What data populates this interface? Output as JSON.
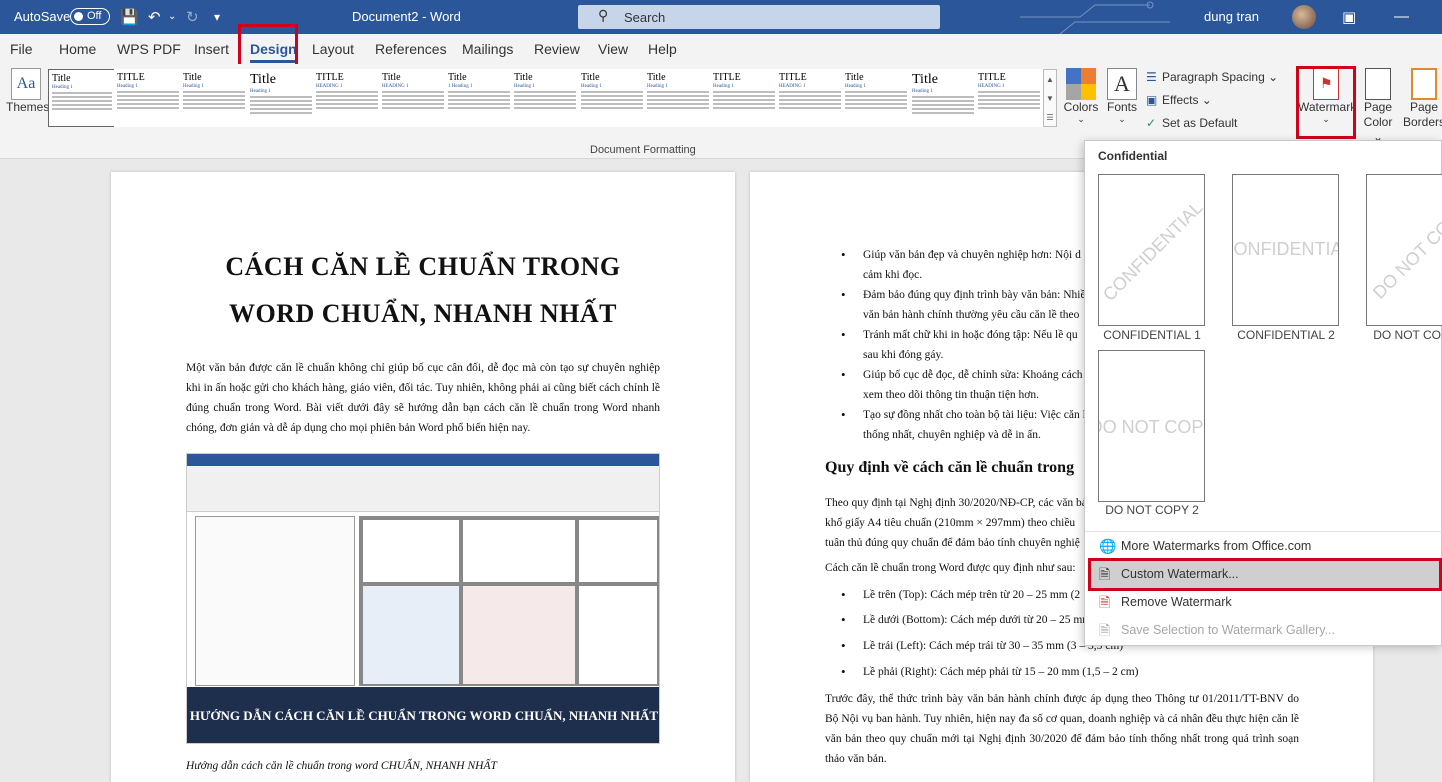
{
  "titlebar": {
    "autosave_label": "AutoSave",
    "autosave_state": "Off",
    "document_title": "Document2  -  Word",
    "search_placeholder": "Search",
    "user_name": "dung tran"
  },
  "tabs": [
    {
      "label": "File"
    },
    {
      "label": "Home"
    },
    {
      "label": "WPS PDF"
    },
    {
      "label": "Insert"
    },
    {
      "label": "Design"
    },
    {
      "label": "Layout"
    },
    {
      "label": "References"
    },
    {
      "label": "Mailings"
    },
    {
      "label": "Review"
    },
    {
      "label": "View"
    },
    {
      "label": "Help"
    }
  ],
  "ribbon": {
    "themes_label": "Themes",
    "colors_label": "Colors",
    "fonts_label": "Fonts",
    "paragraph_spacing_label": "Paragraph Spacing",
    "effects_label": "Effects",
    "set_default_label": "Set as Default",
    "watermark_label": "Watermark",
    "page_color_label_1": "Page",
    "page_color_label_2": "Color",
    "page_borders_label_1": "Page",
    "page_borders_label_2": "Borders",
    "group_label": "Document Formatting",
    "style_titles": [
      "Title",
      "TITLE",
      "Title",
      "Title",
      "TITLE",
      "Title",
      "Title",
      "Title",
      "Title",
      "Title",
      "TITLE",
      "TITLE",
      "Title",
      "Title",
      "TITLE"
    ],
    "style_headings": [
      "Heading 1",
      "Heading 1",
      "Heading 1",
      "Heading 1",
      "HEADING 1",
      "HEADING 1",
      "1 Heading 1",
      "Heading 1",
      "Heading 1",
      "Heading 1",
      "Heading 1",
      "HEADING 1",
      "Heading 1",
      "Heading 1",
      "HEADING 1"
    ]
  },
  "page1": {
    "title_line1": "CÁCH CĂN LỀ CHUẨN TRONG",
    "title_line2": "WORD CHUẨN, NHANH NHẤT",
    "intro": "Một văn bản được căn lề chuẩn không chỉ giúp bố cục cân đối, dễ đọc mà còn tạo sự chuyên nghiệp khi in ấn hoặc gửi cho khách hàng, giáo viên, đối tác. Tuy nhiên, không phải ai cũng biết cách chỉnh lề đúng chuẩn trong Word. Bài viết dưới đây sẽ hướng dẫn bạn cách căn lề chuẩn trong Word nhanh chóng, đơn giản và dễ áp dụng cho mọi phiên bản Word phổ biến hiện nay.",
    "image_banner": "HƯỚNG DẪN CÁCH CĂN LỀ CHUẨN TRONG WORD CHUẨN, NHANH NHẤT",
    "caption": "Hướng dẫn cách căn lề chuẩn trong word CHUẨN, NHANH NHẤT"
  },
  "page2": {
    "bullets_top": [
      {
        "line1": "Giúp văn bản đẹp và chuyên nghiệp hơn: Nội d",
        "line2": "cảm khi đọc."
      },
      {
        "line1": "Đảm bảo đúng quy định trình bày văn bản: Nhiề",
        "line2": "văn bản hành chính thường yêu cầu căn lề theo"
      },
      {
        "line1": "Tránh mất chữ khi in hoặc đóng tập: Nếu lề qu",
        "line2": "sau khi đóng gáy."
      },
      {
        "line1": "Giúp bố cục dễ đọc, dễ chỉnh sửa: Khoảng cách",
        "line2": "xem theo dõi thông tin thuận tiện hơn."
      },
      {
        "line1": "Tạo sự đồng nhất cho toàn bộ tài liệu: Việc căn l",
        "line2": "thống nhất, chuyên nghiệp và dễ in ấn."
      }
    ],
    "heading": "Quy định về cách căn lề chuẩn trong",
    "para1_line1": "Theo quy định tại Nghị định 30/2020/NĐ-CP, các văn bả",
    "para1_line2": "khổ giấy A4 tiêu chuẩn (210mm × 297mm) theo chiều",
    "para1_line3": "tuân thủ đúng quy chuẩn để đảm bảo tính chuyên nghiệ",
    "para2": "Cách căn lề chuẩn trong Word được quy định như sau:",
    "bullets_margin": [
      "Lề trên (Top): Cách mép trên từ 20 – 25 mm (2",
      "Lề dưới (Bottom): Cách mép dưới từ 20 – 25 mm",
      "Lề trái (Left): Cách mép trái từ 30 – 35 mm (3 – 3,5 cm)",
      "Lề phải (Right): Cách mép phải từ 15 – 20 mm (1,5 – 2 cm)"
    ],
    "para3": "Trước đây, thể thức trình bày văn bản hành chính được áp dụng theo Thông tư 01/2011/TT-BNV do Bộ Nội vụ ban hành. Tuy nhiên, hiện nay đa số cơ quan, doanh nghiệp và cá nhân đều thực hiện căn lề văn bản theo quy chuẩn mới tại Nghị định 30/2020 để đảm bảo tính thống nhất trong quá trình soạn thảo văn bản."
  },
  "watermark_menu": {
    "section_title": "Confidential",
    "gallery": [
      {
        "label": "CONFIDENTIAL 1",
        "text": "CONFIDENTIAL",
        "style": "diagonal"
      },
      {
        "label": "CONFIDENTIAL 2",
        "text": "CONFIDENTIAL",
        "style": "horizontal"
      },
      {
        "label": "DO NOT COPY 1",
        "text": "DO NOT COPY",
        "style": "diagonal"
      },
      {
        "label": "DO NOT COPY 2",
        "text": "DO NOT COPY",
        "style": "horizontal"
      }
    ],
    "more_label": "More Watermarks from Office.com",
    "custom_label": "Custom Watermark...",
    "remove_label": "Remove Watermark",
    "save_label": "Save Selection to Watermark Gallery..."
  },
  "colors": {
    "accent": "#2b579a",
    "highlight_box": "#d0021b",
    "menu_highlight": "#cfcfcf",
    "banner": "#1e2f4d"
  }
}
